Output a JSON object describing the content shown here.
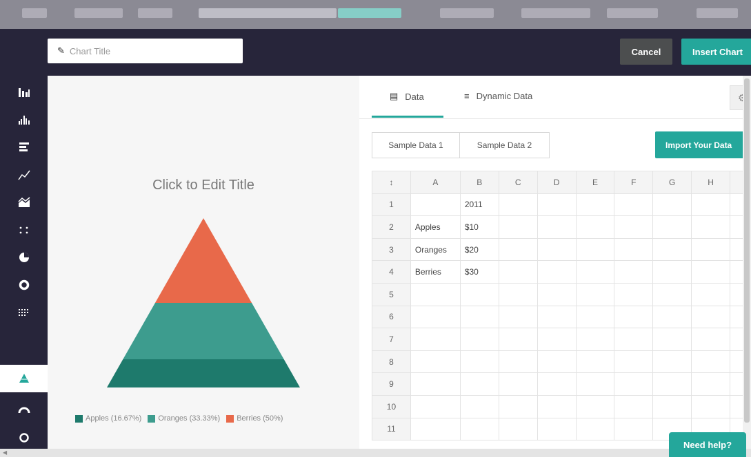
{
  "topbar": {
    "items": [
      "Menu",
      "File",
      "Untitled Infographic",
      "Saved",
      "Preview",
      "Download",
      "Share"
    ]
  },
  "header": {
    "title_placeholder": "Chart Title",
    "cancel_label": "Cancel",
    "insert_label": "Insert Chart"
  },
  "sidebar": {
    "items": [
      {
        "icon": "bar-chart-icon",
        "active": false
      },
      {
        "icon": "histogram-icon",
        "active": false
      },
      {
        "icon": "horizontal-bar-chart-icon",
        "active": false
      },
      {
        "icon": "line-chart-icon",
        "active": false
      },
      {
        "icon": "area-chart-icon",
        "active": false
      },
      {
        "icon": "scatter-chart-icon",
        "active": false
      },
      {
        "icon": "pie-chart-icon",
        "active": false
      },
      {
        "icon": "donut-chart-icon",
        "active": false
      },
      {
        "icon": "dot-grid-chart-icon",
        "active": false
      },
      {
        "icon": "pyramid-chart-icon",
        "active": true
      },
      {
        "icon": "gauge-chart-icon",
        "active": false
      },
      {
        "icon": "ring-chart-icon",
        "active": false
      }
    ]
  },
  "preview": {
    "chart_title": "Click to Edit Title",
    "legend": [
      {
        "label": "Apples (16.67%)",
        "color": "#1e7a6c"
      },
      {
        "label": "Oranges (33.33%)",
        "color": "#3d9c8e"
      },
      {
        "label": "Berries (50%)",
        "color": "#e8694a"
      }
    ]
  },
  "chart_data": {
    "type": "pyramid",
    "title": "Click to Edit Title",
    "categories": [
      "Apples",
      "Oranges",
      "Berries"
    ],
    "values": [
      10,
      20,
      30
    ],
    "percentages": [
      16.67,
      33.33,
      50
    ],
    "colors": [
      "#1e7a6c",
      "#3d9c8e",
      "#e8694a"
    ],
    "series_label": "2011"
  },
  "datapanel": {
    "tabs": [
      {
        "label": "Data",
        "icon": "table-icon",
        "active": true
      },
      {
        "label": "Dynamic Data",
        "icon": "dynamic-data-icon",
        "active": false
      }
    ],
    "gear_icon": "gear-icon",
    "sample_buttons": [
      "Sample Data 1",
      "Sample Data 2"
    ],
    "import_label": "Import Your Data",
    "columns": [
      "A",
      "B",
      "C",
      "D",
      "E",
      "F",
      "G",
      "H"
    ],
    "rows": [
      {
        "num": "1",
        "cells": [
          "",
          "2011"
        ]
      },
      {
        "num": "2",
        "cells": [
          "Apples",
          "$10"
        ]
      },
      {
        "num": "3",
        "cells": [
          "Oranges",
          "$20"
        ]
      },
      {
        "num": "4",
        "cells": [
          "Berries",
          "$30"
        ]
      },
      {
        "num": "5",
        "cells": []
      },
      {
        "num": "6",
        "cells": []
      },
      {
        "num": "7",
        "cells": []
      },
      {
        "num": "8",
        "cells": []
      },
      {
        "num": "9",
        "cells": []
      },
      {
        "num": "10",
        "cells": []
      },
      {
        "num": "11",
        "cells": []
      }
    ]
  },
  "help": {
    "label": "Need help?"
  }
}
